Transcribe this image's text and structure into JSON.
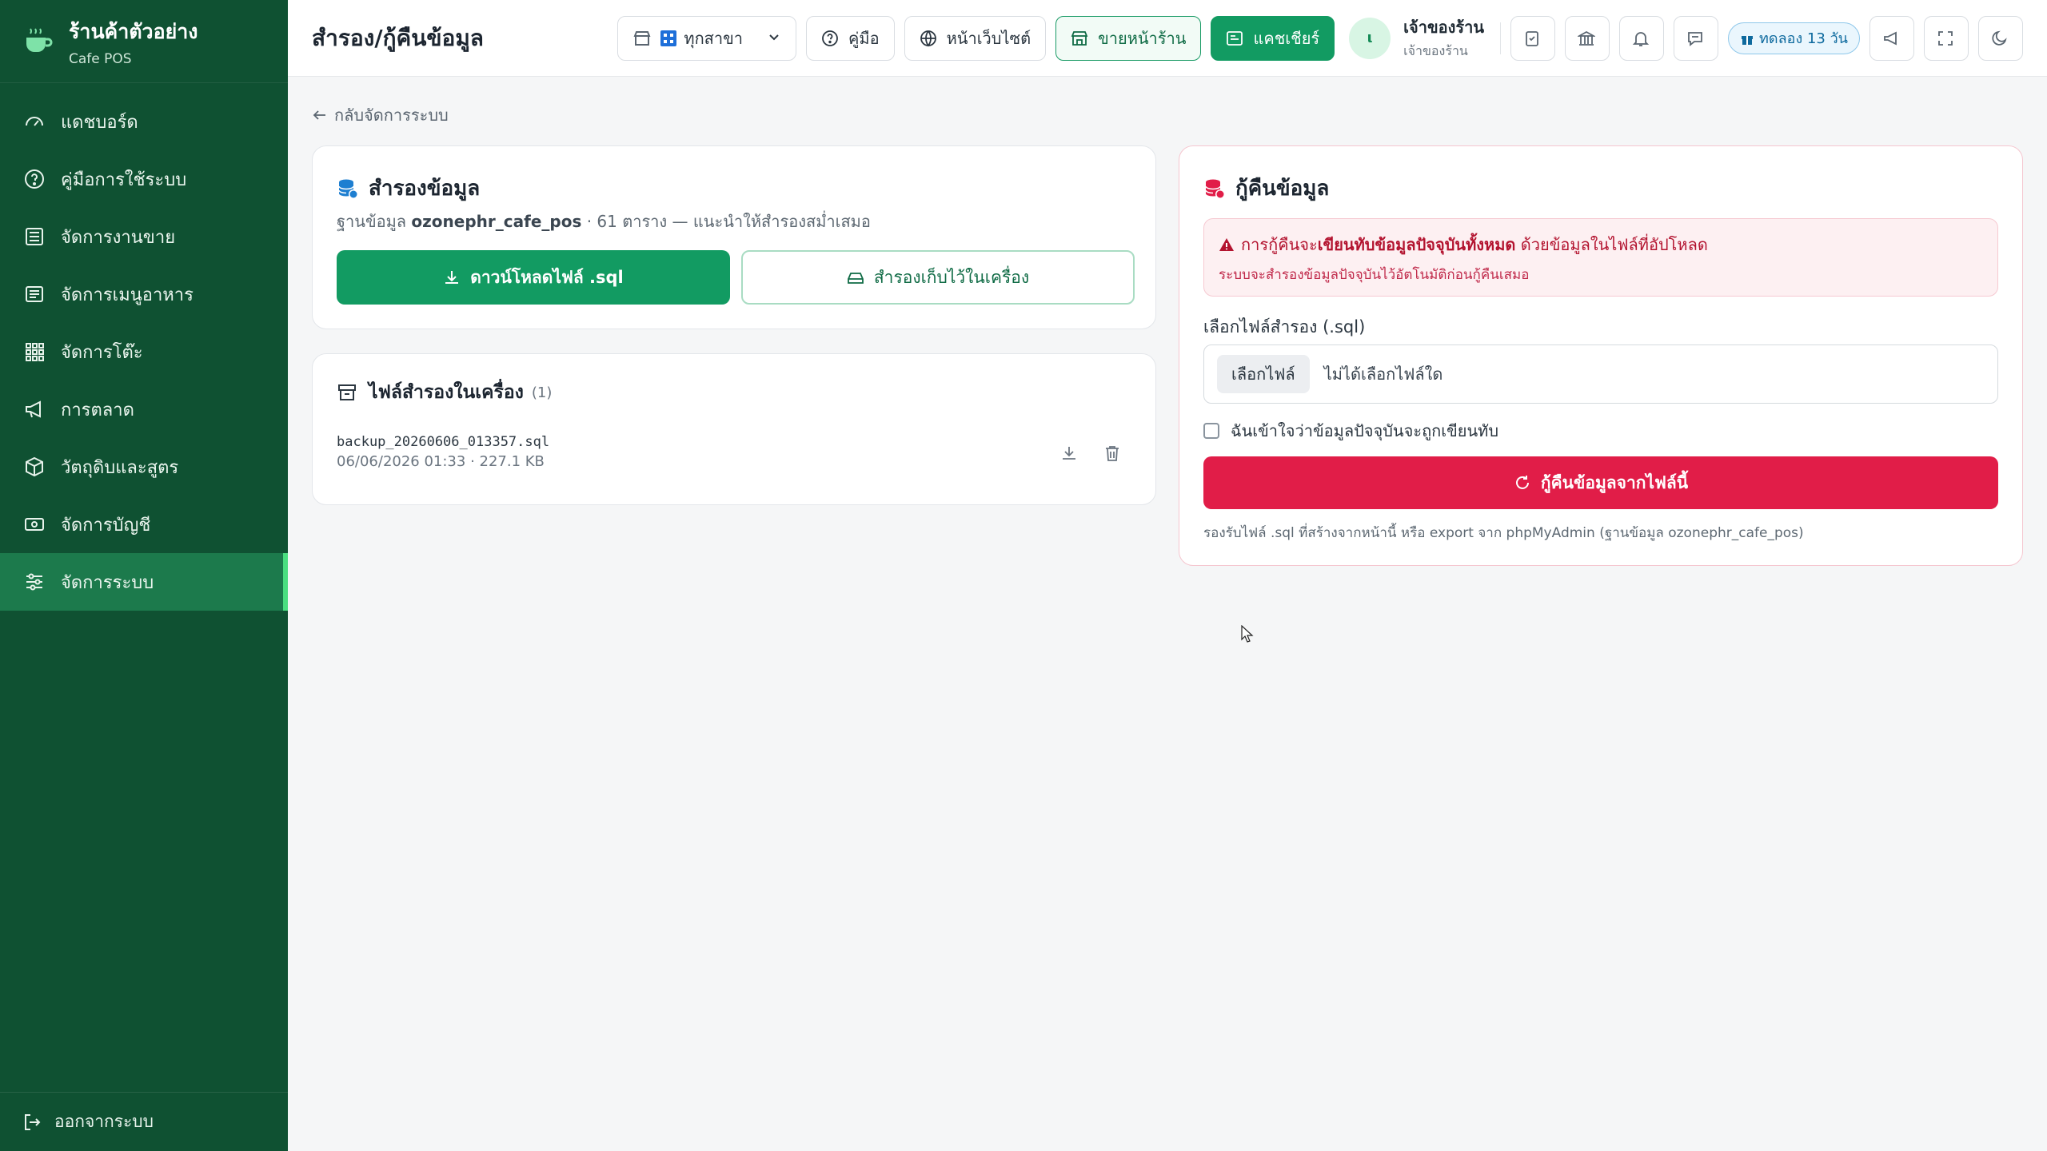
{
  "brand": {
    "name": "ร้านค้าตัวอย่าง",
    "sub": "Cafe POS"
  },
  "sidebar": {
    "items": [
      {
        "label": "แดชบอร์ด",
        "icon": "gauge-icon"
      },
      {
        "label": "คู่มือการใช้ระบบ",
        "icon": "help-circle-icon"
      },
      {
        "label": "จัดการงานขาย",
        "icon": "register-icon"
      },
      {
        "label": "จัดการเมนูอาหาร",
        "icon": "list-icon"
      },
      {
        "label": "จัดการโต๊ะ",
        "icon": "grid-icon"
      },
      {
        "label": "การตลาด",
        "icon": "megaphone-icon"
      },
      {
        "label": "วัตถุดิบและสูตร",
        "icon": "box-icon"
      },
      {
        "label": "จัดการบัญชี",
        "icon": "money-icon"
      },
      {
        "label": "จัดการระบบ",
        "icon": "sliders-icon",
        "active": true
      }
    ],
    "logout": "ออกจากระบบ"
  },
  "header": {
    "title": "สำรอง/กู้คืนข้อมูล",
    "branch": "ทุกสาขา",
    "guide": "คู่มือ",
    "website": "หน้าเว็บไซต์",
    "storefront": "ขายหน้าร้าน",
    "cashier": "แคชเชียร์",
    "user_initial": "ι",
    "user_name": "เจ้าของร้าน",
    "user_role": "เจ้าของร้าน",
    "trial": "ทดลอง 13 วัน"
  },
  "main": {
    "back": "กลับจัดการระบบ",
    "backup": {
      "title": "สำรองข้อมูล",
      "desc_prefix": "ฐานข้อมูล",
      "db_name": "ozonephr_cafe_pos",
      "desc_suffix": "· 61 ตาราง — แนะนำให้สำรองสม่ำเสมอ",
      "download_btn": "ดาวน์โหลดไฟล์ .sql",
      "save_local_btn": "สำรองเก็บไว้ในเครื่อง"
    },
    "local_files": {
      "title": "ไฟล์สำรองในเครื่อง",
      "count": "(1)",
      "files": [
        {
          "name": "backup_20260606_013357.sql",
          "meta": "06/06/2026 01:33 · 227.1 KB"
        }
      ]
    },
    "restore": {
      "title": "กู้คืนข้อมูล",
      "warn_prefix": "การกู้คืนจะ",
      "warn_bold": "เขียนทับข้อมูลปัจจุบันทั้งหมด",
      "warn_suffix": "ด้วยข้อมูลในไฟล์ที่อัปโหลด",
      "warn_sub": "ระบบจะสำรองข้อมูลปัจจุบันไว้อัตโนมัติก่อนกู้คืนเสมอ",
      "file_label": "เลือกไฟล์สำรอง (.sql)",
      "choose_btn": "เลือกไฟล์",
      "no_file": "ไม่ได้เลือกไฟล์ใด",
      "confirm_label": "ฉันเข้าใจว่าข้อมูลปัจจุบันจะถูกเขียนทับ",
      "restore_btn": "กู้คืนข้อมูลจากไฟล์นี้",
      "hint": "รองรับไฟล์ .sql ที่สร้างจากหน้านี้ หรือ export จาก phpMyAdmin (ฐานข้อมูล ozonephr_cafe_pos)"
    }
  },
  "colors": {
    "sidebar": "#0f5132",
    "primary": "#129b62",
    "danger": "#e11d48"
  }
}
